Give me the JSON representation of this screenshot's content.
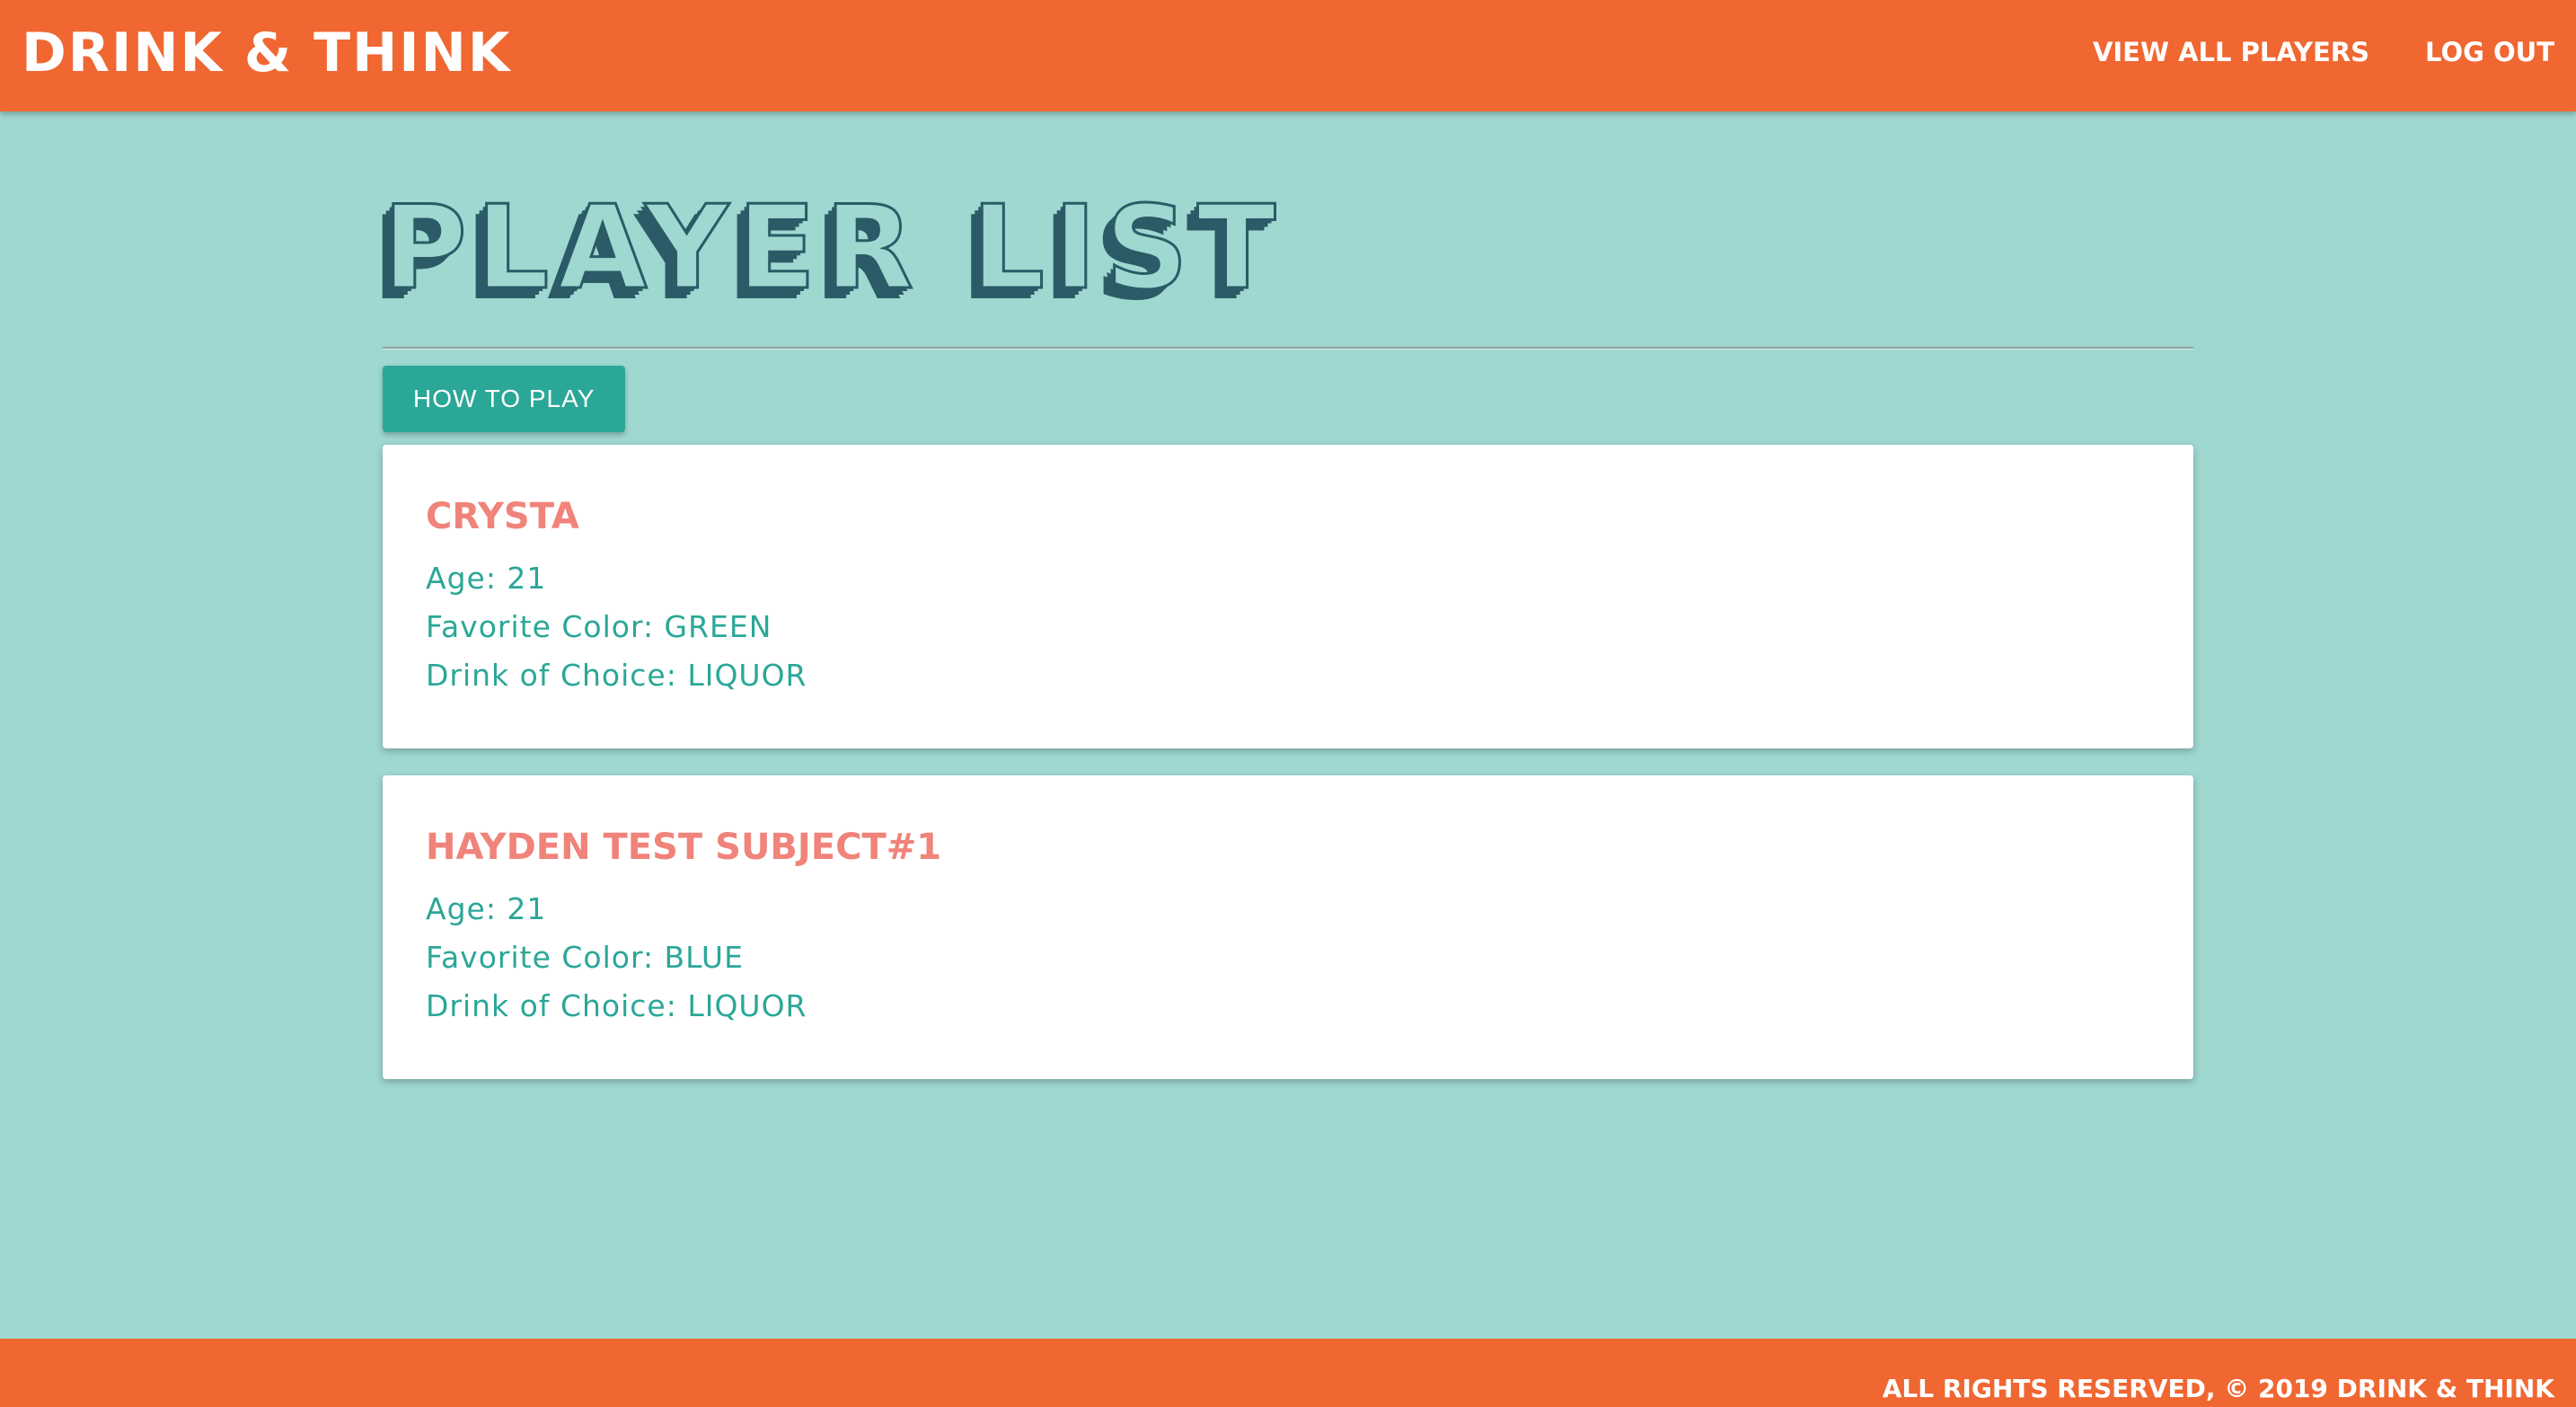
{
  "navbar": {
    "brand": "Drink & Think",
    "links": [
      {
        "label": "View All Players"
      },
      {
        "label": "Log Out"
      }
    ]
  },
  "main": {
    "title": "Player List",
    "how_to_play_label": "How to Play",
    "players": [
      {
        "name": "Crysta",
        "age": "Age: 21",
        "favorite_color": "Favorite Color: GREEN",
        "drink": "Drink of Choice: LIQUOR"
      },
      {
        "name": "Hayden Test Subject#1",
        "age": "Age: 21",
        "favorite_color": "Favorite Color: BLUE",
        "drink": "Drink of Choice: LIQUOR"
      }
    ]
  },
  "footer": {
    "text": "All Rights Reserved, © 2019 Drink & Think"
  },
  "colors": {
    "navbar": "#f06732",
    "background": "#9fd7d1",
    "accent": "#2ba797",
    "player_name": "#f0837a",
    "title_shadow": "#2a5b66"
  }
}
